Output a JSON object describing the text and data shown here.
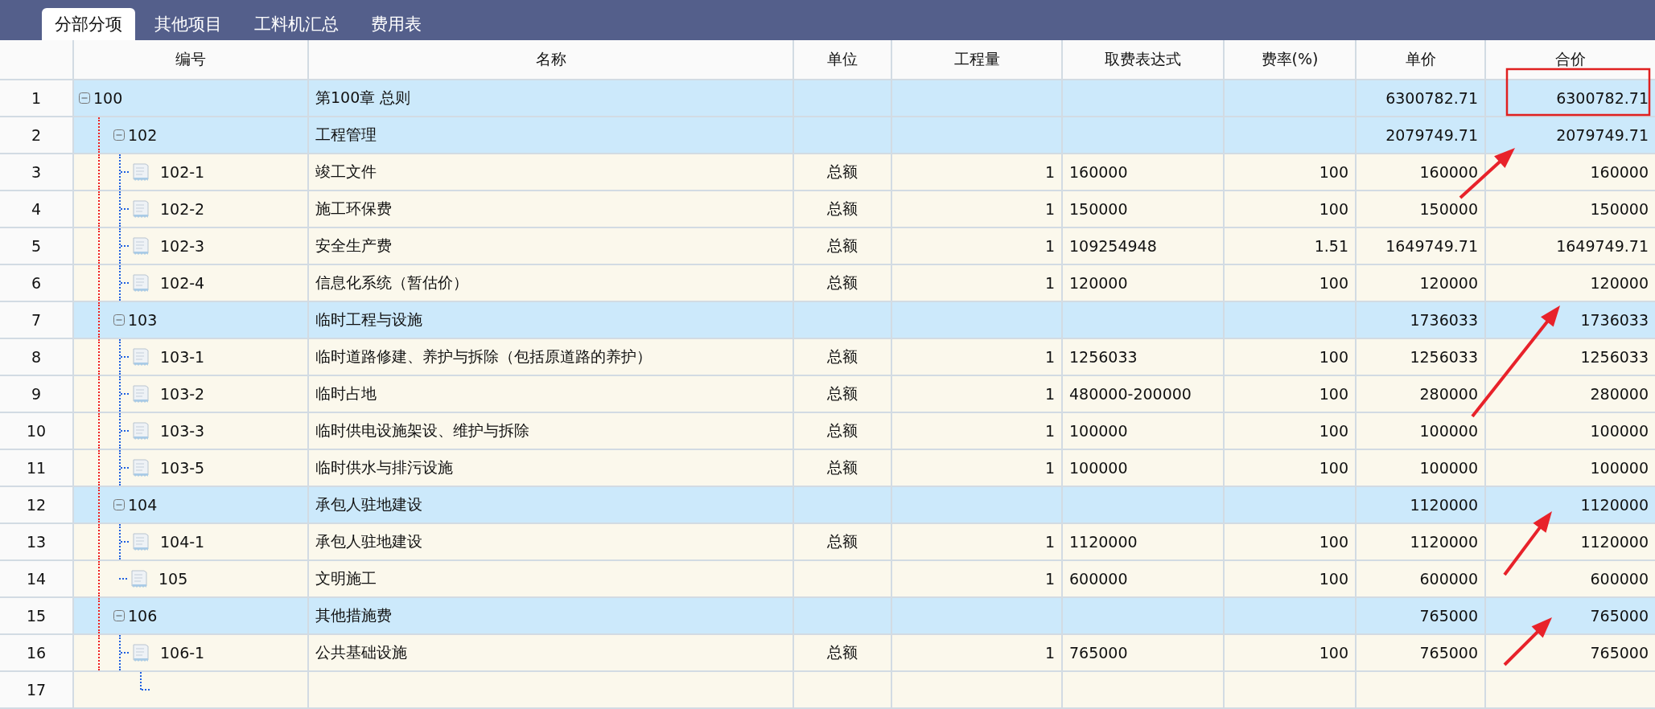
{
  "tabs": [
    {
      "label": "分部分项",
      "selected": true
    },
    {
      "label": "其他项目",
      "selected": false
    },
    {
      "label": "工料机汇总",
      "selected": false
    },
    {
      "label": "费用表",
      "selected": false
    }
  ],
  "table": {
    "columns": [
      "编号",
      "名称",
      "单位",
      "工程量",
      "取费表达式",
      "费率(%)",
      "单价",
      "合价"
    ],
    "rows": [
      {
        "no": "1",
        "kind": "group",
        "expanded": true,
        "code": "100",
        "name": "第100章 总则",
        "price": "6300782.71",
        "total": "6300782.71",
        "children": [
          {
            "no": "2",
            "kind": "group",
            "expanded": true,
            "code": "102",
            "name": "工程管理",
            "price": "2079749.71",
            "total": "2079749.71",
            "children": [
              {
                "no": "3",
                "kind": "item",
                "code": "102-1",
                "name": "竣工文件",
                "unit": "总额",
                "qty": "1",
                "expr": "160000",
                "rate": "100",
                "price": "160000",
                "total": "160000"
              },
              {
                "no": "4",
                "kind": "item",
                "code": "102-2",
                "name": "施工环保费",
                "unit": "总额",
                "qty": "1",
                "expr": "150000",
                "rate": "100",
                "price": "150000",
                "total": "150000"
              },
              {
                "no": "5",
                "kind": "item",
                "code": "102-3",
                "name": "安全生产费",
                "unit": "总额",
                "qty": "1",
                "expr": "109254948",
                "rate": "1.51",
                "price": "1649749.71",
                "total": "1649749.71"
              },
              {
                "no": "6",
                "kind": "item",
                "code": "102-4",
                "name": "信息化系统（暂估价）",
                "unit": "总额",
                "qty": "1",
                "expr": "120000",
                "rate": "100",
                "price": "120000",
                "total": "120000"
              }
            ]
          },
          {
            "no": "7",
            "kind": "group",
            "expanded": true,
            "code": "103",
            "name": "临时工程与设施",
            "price": "1736033",
            "total": "1736033",
            "children": [
              {
                "no": "8",
                "kind": "item",
                "code": "103-1",
                "name": "临时道路修建、养护与拆除（包括原道路的养护）",
                "unit": "总额",
                "qty": "1",
                "expr": "1256033",
                "rate": "100",
                "price": "1256033",
                "total": "1256033"
              },
              {
                "no": "9",
                "kind": "item",
                "code": "103-2",
                "name": "临时占地",
                "unit": "总额",
                "qty": "1",
                "expr": "480000-200000",
                "rate": "100",
                "price": "280000",
                "total": "280000"
              },
              {
                "no": "10",
                "kind": "item",
                "code": "103-3",
                "name": "临时供电设施架设、维护与拆除",
                "unit": "总额",
                "qty": "1",
                "expr": "100000",
                "rate": "100",
                "price": "100000",
                "total": "100000"
              },
              {
                "no": "11",
                "kind": "item",
                "code": "103-5",
                "name": "临时供水与排污设施",
                "unit": "总额",
                "qty": "1",
                "expr": "100000",
                "rate": "100",
                "price": "100000",
                "total": "100000"
              }
            ]
          },
          {
            "no": "12",
            "kind": "group",
            "expanded": true,
            "code": "104",
            "name": "承包人驻地建设",
            "price": "1120000",
            "total": "1120000",
            "children": [
              {
                "no": "13",
                "kind": "item",
                "code": "104-1",
                "name": "承包人驻地建设",
                "unit": "总额",
                "qty": "1",
                "expr": "1120000",
                "rate": "100",
                "price": "1120000",
                "total": "1120000"
              }
            ]
          },
          {
            "no": "14",
            "kind": "item",
            "code": "105",
            "name": "文明施工",
            "qty": "1",
            "expr": "600000",
            "rate": "100",
            "price": "600000",
            "total": "600000"
          },
          {
            "no": "15",
            "kind": "group",
            "expanded": true,
            "code": "106",
            "name": "其他措施费",
            "price": "765000",
            "total": "765000",
            "children": [
              {
                "no": "16",
                "kind": "item",
                "code": "106-1",
                "name": "公共基础设施",
                "unit": "总额",
                "qty": "1",
                "expr": "765000",
                "rate": "100",
                "price": "765000",
                "total": "765000"
              }
            ]
          }
        ]
      }
    ],
    "blank_row": {
      "no": "17"
    }
  }
}
